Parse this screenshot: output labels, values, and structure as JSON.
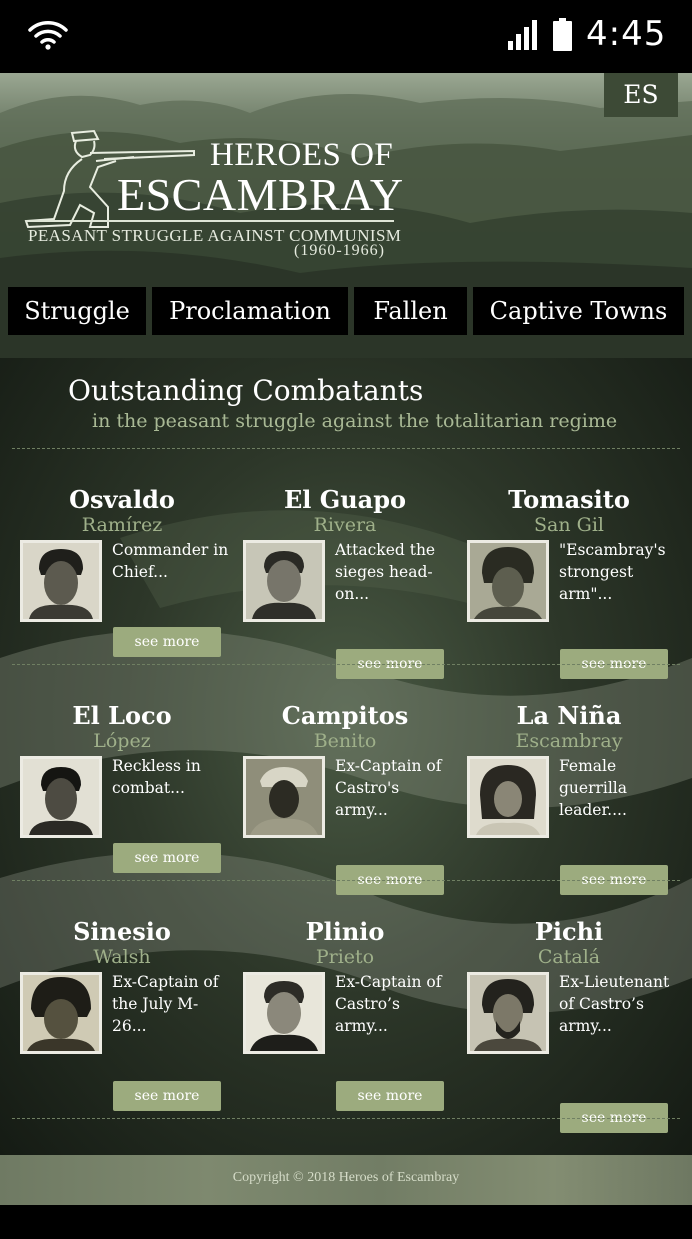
{
  "status_bar": {
    "time": "4:45"
  },
  "header": {
    "lang_button": "ES",
    "title_line1": "HEROES OF",
    "title_line2": "ESCAMBRAY",
    "subtitle": "PEASANT STRUGGLE AGAINST COMMUNISM",
    "years": "(1960-1966)"
  },
  "nav": {
    "items": [
      {
        "label": "Struggle"
      },
      {
        "label": "Proclamation"
      },
      {
        "label": "Fallen"
      },
      {
        "label": "Captive Towns"
      }
    ]
  },
  "section": {
    "title": "Outstanding Combatants",
    "subtitle": "in the peasant struggle against the totalitarian regime"
  },
  "combatants": [
    {
      "first": "Osvaldo",
      "last": "Ramírez",
      "desc": "Commander in Chief...",
      "button": "see more"
    },
    {
      "first": "El Guapo",
      "last": "Rivera",
      "desc": "Attacked the sieges head-on...",
      "button": "see more"
    },
    {
      "first": "Tomasito",
      "last": "San Gil",
      "desc": "\"Escambray's strongest arm\"...",
      "button": "see more"
    },
    {
      "first": "El Loco",
      "last": "López",
      "desc": "Reckless in combat...",
      "button": "see more"
    },
    {
      "first": "Campitos",
      "last": "Benito",
      "desc": "Ex-Captain of Castro's army...",
      "button": "see more"
    },
    {
      "first": "La Niña",
      "last": "Escambray",
      "desc": "Female guerrilla leader....",
      "button": "see more"
    },
    {
      "first": "Sinesio",
      "last": "Walsh",
      "desc": "Ex-Captain of the July M-26...",
      "button": "see more"
    },
    {
      "first": "Plinio",
      "last": "Prieto",
      "desc": "Ex-Captain of Castro’s army...",
      "button": "see more"
    },
    {
      "first": "Pichi",
      "last": "Catalá",
      "desc": "Ex-Lieutenant of Castro’s army...",
      "button": "see more"
    }
  ],
  "footer": {
    "copyright": "Copyright © 2018 Heroes of Escambray"
  },
  "icons": {
    "wifi": "wifi-icon",
    "signal": "signal-icon",
    "battery": "battery-icon",
    "soldier": "soldier-logo-icon"
  },
  "colors": {
    "button_bg": "#9cab7e",
    "accent_text": "#9fb08a",
    "nav_bg": "#000000"
  }
}
